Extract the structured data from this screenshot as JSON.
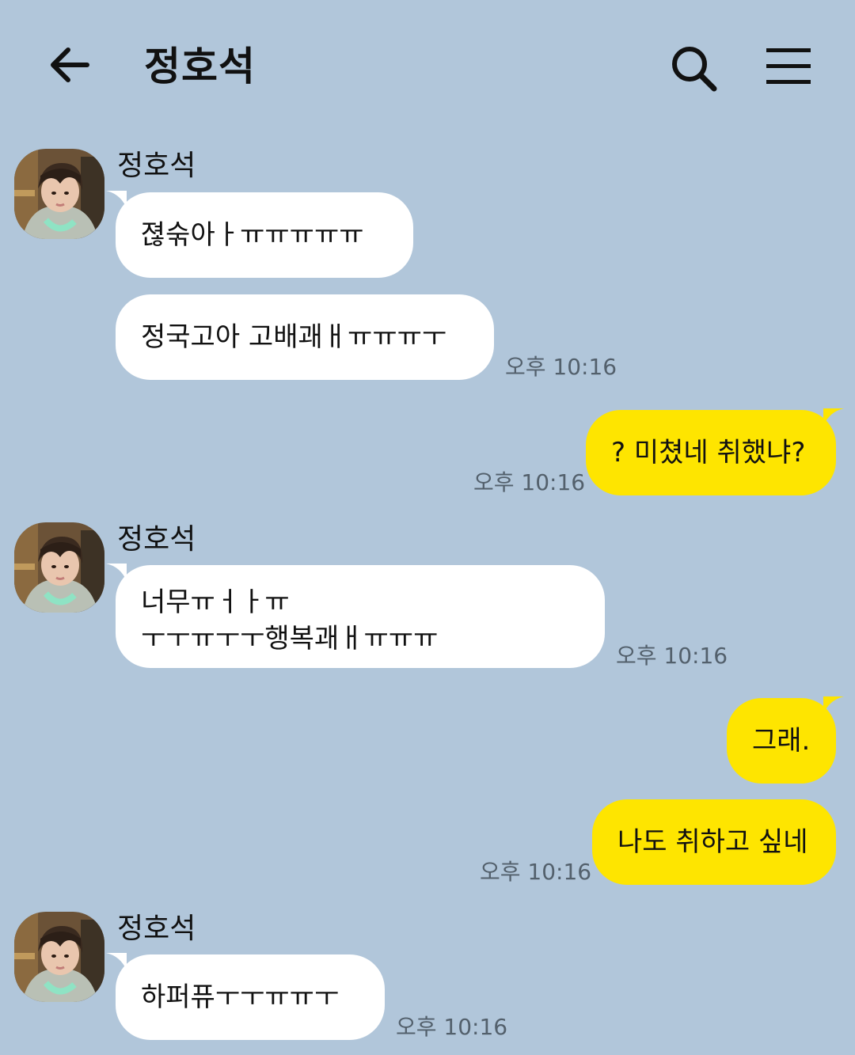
{
  "header": {
    "title": "정호석",
    "icons": [
      "back-arrow-icon",
      "search-icon",
      "menu-icon"
    ]
  },
  "colors": {
    "background": "#b1c6da",
    "incoming_bubble": "#ffffff",
    "outgoing_bubble": "#fee500"
  },
  "messages": [
    {
      "sender": "정호석",
      "text": "젾숚아ㅏㅠㅠㅠㅠㅠ"
    },
    {
      "text": "정국고아 고배괘ㅐㅠㅠㅠㅜ",
      "time": "오후 10:16"
    },
    {
      "text": "? 미쳤네 취했냐?",
      "time": "오후 10:16"
    },
    {
      "sender": "정호석",
      "line1": "너무ㅠㅓㅏㅠ",
      "line2": "ㅜㅜㅠㅜㅜ행복괘ㅐㅠㅠㅠ",
      "time": "오후 10:16"
    },
    {
      "text": "그래."
    },
    {
      "text": "나도 취하고 싶네",
      "time": "오후 10:16"
    },
    {
      "sender": "정호석",
      "text": "하퍼퓨ㅜㅜㅠㅠㅜ",
      "time": "오후 10:16"
    }
  ]
}
